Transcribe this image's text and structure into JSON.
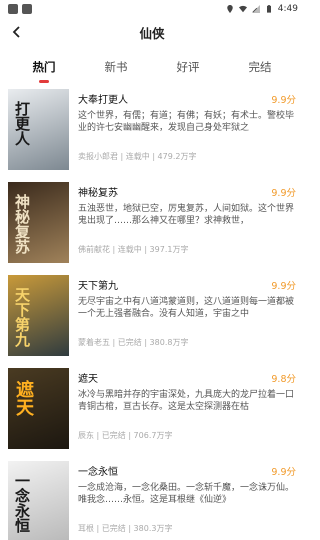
{
  "status": {
    "time": "4:49"
  },
  "header": {
    "title": "仙侠"
  },
  "tabs": [
    {
      "label": "热门"
    },
    {
      "label": "新书"
    },
    {
      "label": "好评"
    },
    {
      "label": "完结"
    }
  ],
  "books": [
    {
      "name": "大奉打更人",
      "score": "9.9分",
      "desc": "这个世界，有儒；有道；有佛；有妖；有术士。警校毕业的许七安幽幽醒来，发现自己身处牢狱之",
      "meta": "卖报小郎君 | 连载中 | 479.2万字",
      "cover_title": "打更人",
      "cover_colors": [
        "#e9ecef",
        "#7d8891"
      ]
    },
    {
      "name": "神秘复苏",
      "score": "9.9分",
      "desc": "五浊恶世，地狱已空，厉鬼复苏，人间如狱。这个世界鬼出现了……那么神又在哪里？求神救世，",
      "meta": "佛前献花 | 连载中 | 397.1万字",
      "cover_title": "神秘复苏",
      "cover_colors": [
        "#3a2a1c",
        "#a0825a"
      ]
    },
    {
      "name": "天下第九",
      "score": "9.9分",
      "desc": "无尽宇宙之中有八道鸿蒙道则，这八道道则每一道都被一个无上强者融合。没有人知道，宇宙之中",
      "meta": "蒙着老五 | 已完结 | 380.8万字",
      "cover_title": "天下第九",
      "cover_colors": [
        "#c99a3a",
        "#2f3b3f"
      ]
    },
    {
      "name": "遮天",
      "score": "9.8分",
      "desc": "冰冷与黑暗并存的宇宙深处，九具庞大的龙尸拉着一口青铜古棺，亘古长存。这是太空探测器在枯",
      "meta": "辰东 | 已完结 | 706.7万字",
      "cover_title": "遮天",
      "cover_colors": [
        "#4a3b22",
        "#1c1710"
      ]
    },
    {
      "name": "一念永恒",
      "score": "9.9分",
      "desc": "一念成沧海，一念化桑田。一念斩千魔，一念诛万仙。唯我念……永恒。这是耳根继《仙逆》",
      "meta": "耳根 | 已完结 | 380.3万字",
      "cover_title": "一念永恒",
      "cover_colors": [
        "#f2f2f2",
        "#b9b9b9"
      ]
    }
  ]
}
